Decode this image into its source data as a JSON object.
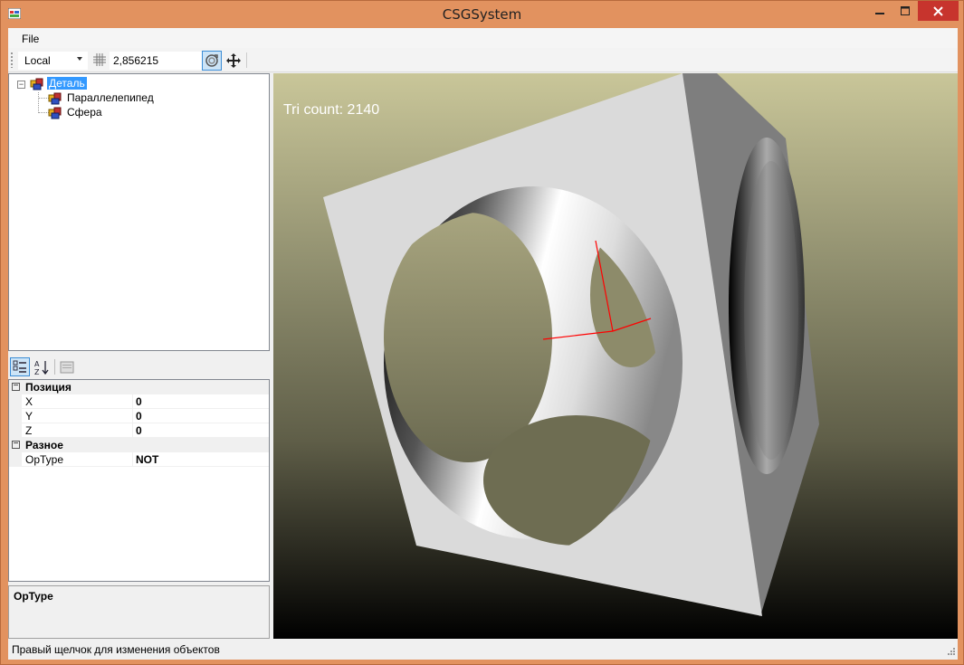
{
  "window": {
    "title": "CSGSystem"
  },
  "menu": {
    "file": "File"
  },
  "toolbar": {
    "coord_mode": "Local",
    "grid_size": "2,856215",
    "tools": [
      "rotate-icon",
      "move-icon"
    ]
  },
  "tree": {
    "root": "Деталь",
    "children": [
      "Параллелепипед",
      "Сфера"
    ]
  },
  "properties": {
    "categories": [
      {
        "name": "Позиция",
        "rows": [
          {
            "name": "X",
            "value": "0"
          },
          {
            "name": "Y",
            "value": "0"
          },
          {
            "name": "Z",
            "value": "0"
          }
        ]
      },
      {
        "name": "Разное",
        "rows": [
          {
            "name": "OpType",
            "value": "NOT"
          }
        ]
      }
    ],
    "help_title": "OpType"
  },
  "viewport": {
    "tri_count": "Tri count: 2140"
  },
  "status": {
    "text": "Правый щелчок для изменения объектов"
  },
  "colors": {
    "accent": "#3399ff",
    "titlebar": "#e2925f",
    "close": "#c7342d",
    "axis": "#ff0000"
  }
}
